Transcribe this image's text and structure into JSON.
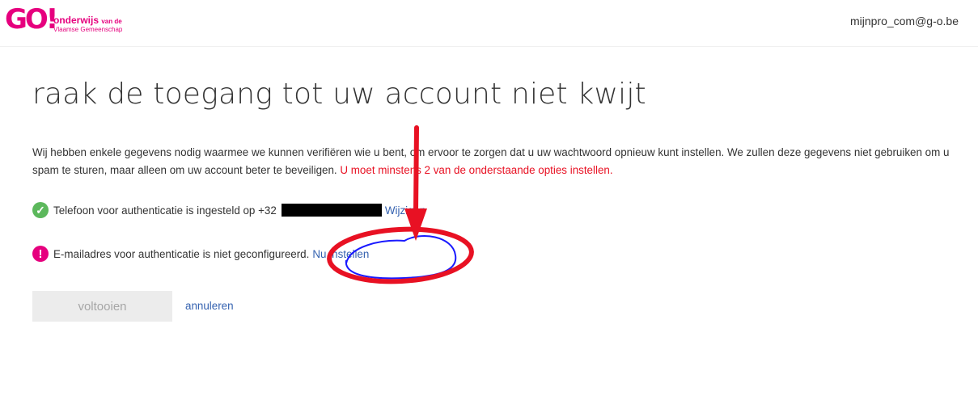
{
  "header": {
    "logo": {
      "mark": "GO!",
      "line1": "onderwijs",
      "line1_suffix": "van de",
      "line2": "Vlaamse Gemeenschap"
    },
    "user_email": "mijnpro_com@g-o.be"
  },
  "page": {
    "title": "raak de toegang tot uw account niet kwijt",
    "intro": "Wij hebben enkele gegevens nodig waarmee we kunnen verifiëren wie u bent, om ervoor te zorgen dat u uw wachtwoord opnieuw kunt instellen. We zullen deze gegevens niet gebruiken om u spam te sturen, maar alleen om uw account beter te beveiligen.",
    "warning": "U moet minstens 2 van de onderstaande opties instellen."
  },
  "options": {
    "phone": {
      "text": "Telefoon voor authenticatie is ingesteld op +32",
      "link": "Wijzigen",
      "icon": "check-circle-icon",
      "status_color": "#5cb85c"
    },
    "email": {
      "text": "E-mailadres voor authenticatie is niet geconfigureerd.",
      "link": "Nu instellen",
      "icon": "exclamation-circle-icon",
      "status_color": "#e6007e"
    }
  },
  "actions": {
    "finish": "voltooien",
    "cancel": "annuleren"
  },
  "annotations": {
    "arrow_color": "#e81123",
    "circle_color": "#e81123",
    "scribble_color": "#1a1aff"
  }
}
